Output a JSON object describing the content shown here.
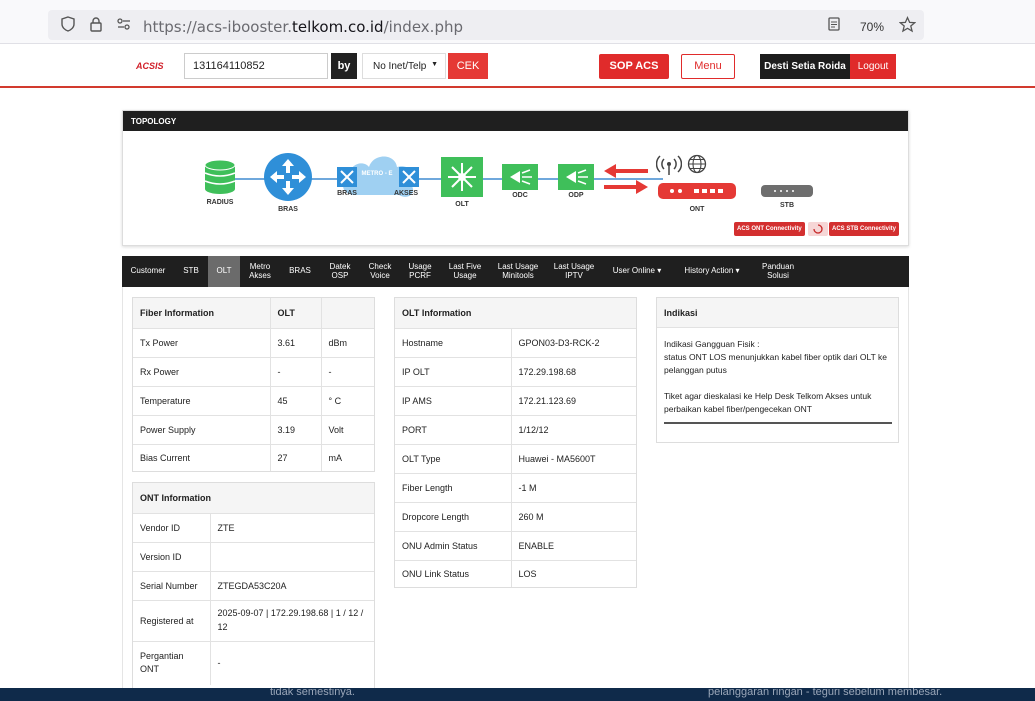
{
  "browser": {
    "url_prefix": "https://acs-ibooster.",
    "url_domain": "telkom.co.id",
    "url_suffix": "/index.php",
    "zoom": "70%"
  },
  "navbar": {
    "logo": "ACSIS",
    "search_value": "131164110852",
    "by_label": "by",
    "select_value": "No Inet/Telp",
    "cek_label": "CEK",
    "sop_label": "SOP ACS",
    "menu_label": "Menu",
    "user_name": "Desti Setia Roida",
    "logout_label": "Logout"
  },
  "topology": {
    "title": "TOPOLOGY",
    "nodes": {
      "radius": "RADIUS",
      "bras": "BRAS",
      "bras2": "BRAS",
      "metro": "METRO - E",
      "akses": "AKSES",
      "olt": "OLT",
      "odc": "ODC",
      "odp": "ODP",
      "ont": "ONT",
      "stb": "STB"
    },
    "acs_ont": "ACS ONT Connectivity",
    "acs_stb": "ACS STB Connectivity"
  },
  "tabs": [
    {
      "label": "Customer"
    },
    {
      "label": "STB"
    },
    {
      "label": "OLT"
    },
    {
      "label": "Metro Akses"
    },
    {
      "label": "BRAS"
    },
    {
      "label": "Datek OSP"
    },
    {
      "label": "Check Voice"
    },
    {
      "label": "Usage PCRF"
    },
    {
      "label": "Last Five Usage"
    },
    {
      "label": "Last Usage Minitools"
    },
    {
      "label": "Last Usage IPTV"
    },
    {
      "label": "User Online ▾"
    },
    {
      "label": "History Action ▾"
    },
    {
      "label": "Panduan Solusi"
    }
  ],
  "fiber": {
    "header": [
      "Fiber Information",
      "OLT",
      ""
    ],
    "rows": [
      [
        "Tx Power",
        "3.61",
        "dBm"
      ],
      [
        "Rx Power",
        "-",
        "-"
      ],
      [
        "Temperature",
        "45",
        "° C"
      ],
      [
        "Power Supply",
        "3.19",
        "Volt"
      ],
      [
        "Bias Current",
        "27",
        "mA"
      ]
    ]
  },
  "ont": {
    "header": "ONT Information",
    "rows": [
      [
        "Vendor ID",
        "ZTE"
      ],
      [
        "Version ID",
        ""
      ],
      [
        "Serial Number",
        "ZTEGDA53C20A"
      ],
      [
        "Registered at",
        "2025-09-07 | 172.29.198.68 | 1 / 12 / 12"
      ],
      [
        "Pergantian ONT",
        "-"
      ]
    ]
  },
  "olt_info": {
    "header": "OLT Information",
    "rows": [
      [
        "Hostname",
        "GPON03-D3-RCK-2"
      ],
      [
        "IP OLT",
        "172.29.198.68"
      ],
      [
        "IP AMS",
        "172.21.123.69"
      ],
      [
        "PORT",
        "1/12/12"
      ],
      [
        "OLT Type",
        "Huawei - MA5600T"
      ],
      [
        "Fiber Length",
        "-1 M"
      ],
      [
        "Dropcore Length",
        "260 M"
      ],
      [
        "ONU Admin Status",
        "ENABLE"
      ],
      [
        "ONU Link Status",
        "LOS"
      ]
    ]
  },
  "indikasi": {
    "header": "Indikasi",
    "line1": "Indikasi Gangguan Fisik :",
    "line2": "status ONT LOS menunjukkan kabel fiber optik dari OLT ke pelanggan putus",
    "line3": "Tiket agar dieskalasi ke Help Desk Telkom Akses untuk perbaikan kabel fiber/pengecekan ONT"
  },
  "bottom": {
    "left_text": "tidak semestinya.",
    "right_text": "pelanggaran ringan - teguri sebelum membesar."
  },
  "colors": {
    "brand_red": "#e02b2b",
    "dark": "#1f1f1f",
    "topo_green": "#3fbf5a",
    "topo_blue": "#2f8fd8"
  }
}
